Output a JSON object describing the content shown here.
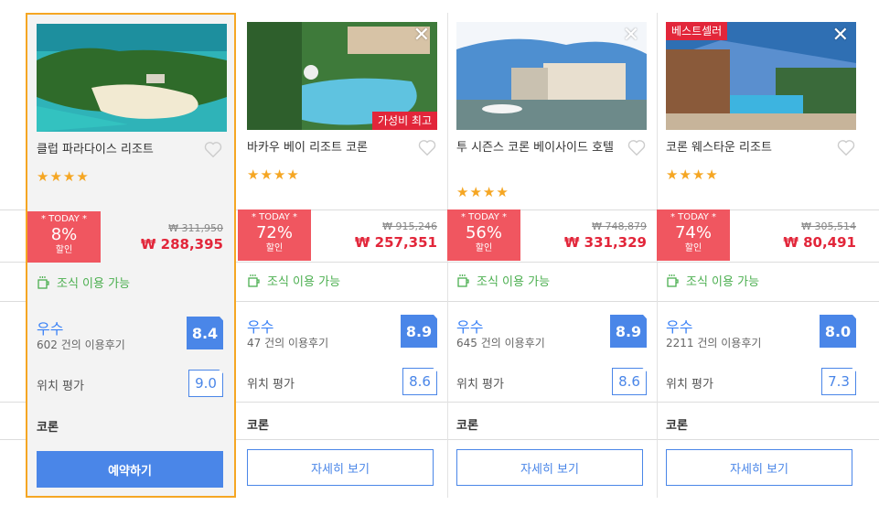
{
  "hotels": [
    {
      "name": "클럽 파라다이스 리조트",
      "stars": "★★★★",
      "today_label": "* TODAY *",
      "discount_pct": "8%",
      "discount_label": "할인",
      "old_price": "₩ 311,950",
      "new_price": "₩ 288,395",
      "breakfast": "조식 이용 가능",
      "grade": "우수",
      "reviews": "602 건의 이용후기",
      "score": "8.4",
      "location_label": "위치 평가",
      "location_score": "9.0",
      "city": "코론",
      "button": "예약하기",
      "badge": ""
    },
    {
      "name": "바카우 베이 리조트 코론",
      "stars": "★★★★",
      "today_label": "* TODAY *",
      "discount_pct": "72%",
      "discount_label": "할인",
      "old_price": "₩ 915,246",
      "new_price": "₩ 257,351",
      "breakfast": "조식 이용 가능",
      "grade": "우수",
      "reviews": "47 건의 이용후기",
      "score": "8.9",
      "location_label": "위치 평가",
      "location_score": "8.6",
      "city": "코론",
      "button": "자세히 보기",
      "badge": "가성비 최고"
    },
    {
      "name": "투 시즌스 코론 베이사이드 호텔",
      "stars": "★★★★",
      "today_label": "* TODAY *",
      "discount_pct": "56%",
      "discount_label": "할인",
      "old_price": "₩ 748,879",
      "new_price": "₩ 331,329",
      "breakfast": "조식 이용 가능",
      "grade": "우수",
      "reviews": "645 건의 이용후기",
      "score": "8.9",
      "location_label": "위치 평가",
      "location_score": "8.6",
      "city": "코론",
      "button": "자세히 보기",
      "badge": ""
    },
    {
      "name": "코론 웨스타운 리조트",
      "stars": "★★★★",
      "today_label": "* TODAY *",
      "discount_pct": "74%",
      "discount_label": "할인",
      "old_price": "₩ 305,514",
      "new_price": "₩ 80,491",
      "breakfast": "조식 이용 가능",
      "grade": "우수",
      "reviews": "2211 건의 이용후기",
      "score": "8.0",
      "location_label": "위치 평가",
      "location_score": "7.3",
      "city": "코론",
      "button": "자세히 보기",
      "badge": "베스트셀러"
    }
  ],
  "close_symbol": "✕",
  "colors": {
    "accent": "#4a86e8",
    "sale": "#f05660",
    "price": "#e2263a",
    "breakfast": "#4caf50",
    "selected_border": "#f5a623",
    "stars": "#f5a623"
  }
}
